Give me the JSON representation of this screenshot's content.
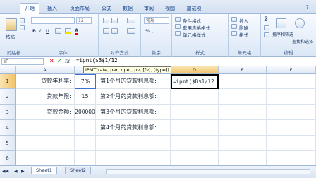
{
  "ribbon_tabs": [
    "开始",
    "插入",
    "页面布局",
    "公式",
    "数据",
    "审阅",
    "视图",
    "加载项"
  ],
  "ribbon": {
    "paste_label": "粘贴",
    "font_size": "12",
    "groups": [
      "剪贴板",
      "字体",
      "对齐方式",
      "数字",
      "样式",
      "单元格",
      "编辑"
    ],
    "number_format": "常规",
    "styles": [
      "条件格式",
      "套用表格格式",
      "单元格样式"
    ],
    "cells": [
      "插入",
      "删除",
      "格式"
    ],
    "edit": [
      "排序和筛选",
      "查找和选择"
    ]
  },
  "formula_bar": {
    "name_box": "IF",
    "formula": "=ipmt($B$1/12"
  },
  "tooltip": "IPMT(rate, per, nper, pv, [fv], [type])",
  "columns": [
    "A",
    "B",
    "C",
    "D",
    "E",
    "F"
  ],
  "rows": [
    "1",
    "2",
    "3",
    "4",
    "5",
    "6"
  ],
  "cells": {
    "a1": "贷款年利率:",
    "b1": "7%",
    "c1": "第1个月的贷款利息额:",
    "d1": "=ipmt($B$1/12",
    "a2": "贷款年限:",
    "b2": "15",
    "c2": "第2个月的贷款利息额:",
    "a3": "贷款金额:",
    "b3": "200000",
    "c3": "第3个月的贷款利息额:",
    "c4": "第4个月的贷款利息额:"
  },
  "sheet_tabs": [
    "Sheet1",
    "Sheet2"
  ],
  "accent_color": "#15428b"
}
